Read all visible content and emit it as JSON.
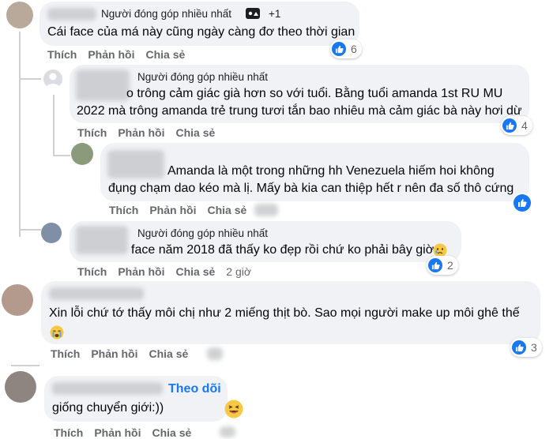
{
  "labels": {
    "top_contributor": "Người đóng góp nhiều nhất",
    "like": "Thích",
    "reply": "Phản hồi",
    "share": "Chia sẻ",
    "follow": "Theo dõi"
  },
  "comments": [
    {
      "id": "c1",
      "badge_extra": "+1",
      "text": [
        "Cái face của má này cũng ngày càng đơ theo thời gian"
      ],
      "likes": "6"
    },
    {
      "id": "c2",
      "text": [
        "o trông cảm giác già hơn so với tuổi. Bằng tuổi amanda 1st RU MU",
        "2022 mà trông amanda trẻ trung tươi tắn bao nhiêu mà cảm giác bà này hơi dừ"
      ],
      "likes": "4"
    },
    {
      "id": "c3",
      "text": [
        "Amanda là một trong những hh Venezuela hiếm hoi không",
        "đụng chạm dao kéo mà lị. Mấy bà kia can thiệp hết r nên đa số thô cứng"
      ],
      "likes": ""
    },
    {
      "id": "c4",
      "text": [
        "face năm 2018 đã thấy ko đẹp rồi chứ ko phải bây giờ"
      ],
      "time": "2 giờ",
      "likes": "2"
    },
    {
      "id": "c5",
      "text": [
        "Xin lỗi chứ tớ thấy môi chị như 2 miếng thịt bò. Sao mọi người make up môi ghê thế"
      ],
      "likes": "3"
    },
    {
      "id": "c6",
      "text": [
        "giống chuyển giới:))"
      ],
      "likes": ""
    }
  ],
  "colors": {
    "bubble": "#f0f2f5",
    "like_blue": "#1877f2",
    "action_gray": "#65676b"
  },
  "icons": [
    "like-thumb-icon",
    "top-contributor-badge-icon",
    "sad-crying-emoji-icon",
    "laughing-emoji-icon",
    "placeholder-avatar-icon"
  ]
}
